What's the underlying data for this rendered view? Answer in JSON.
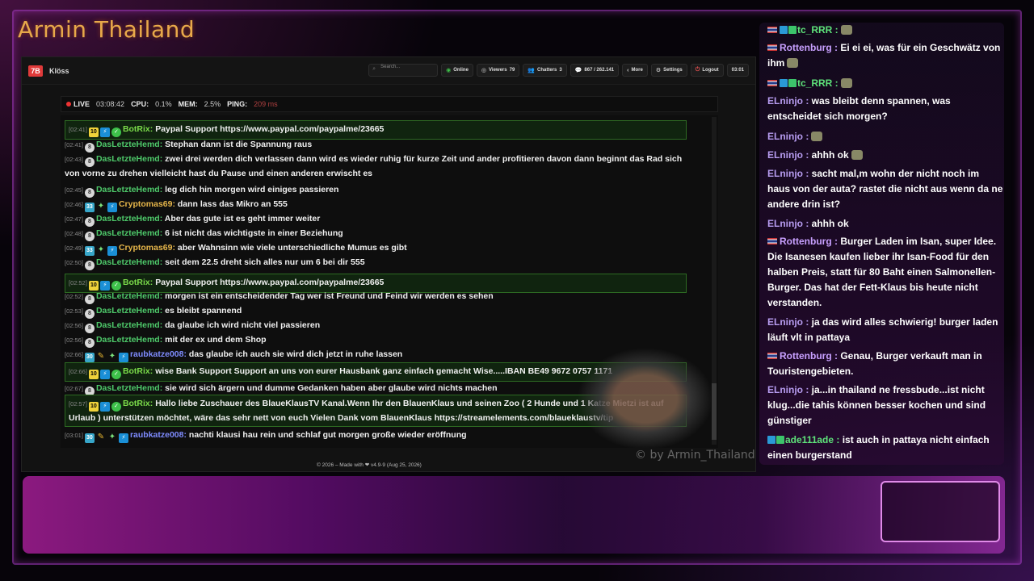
{
  "channel_title": "Armin Thailand",
  "app": {
    "name": "Klöss",
    "search_placeholder": "Search...",
    "online_label": "Online",
    "viewers_label": "Viewers",
    "viewers_count": "79",
    "chatters_label": "Chatters",
    "chatters_count": "3",
    "messages_count": "867 / 262.141",
    "more_label": "More",
    "settings_label": "Settings",
    "logout_label": "Logout",
    "clock": "03:01"
  },
  "status": {
    "live_label": "LIVE",
    "live_time": "03:08:42",
    "cpu_label": "CPU:",
    "cpu_value": "0.1%",
    "mem_label": "MEM:",
    "mem_value": "2.5%",
    "ping_label": "PING:",
    "ping_value": "209 ms"
  },
  "chat": [
    {
      "ts": "[02:41]",
      "badge": "10",
      "user": "BotRix:",
      "text": " Paypal Support https://www.paypal.com/paypalme/23665",
      "kind": "bot"
    },
    {
      "ts": "[02:41]",
      "badge": "8",
      "user": "DasLetzteHemd:",
      "text": " Stephan dann ist die Spannung raus",
      "kind": "green"
    },
    {
      "ts": "[02:43]",
      "badge": "8",
      "user": "DasLetzteHemd:",
      "text": " zwei drei werden dich verlassen dann wird es wieder ruhig für kurze Zeit und ander profitieren davon dann beginnt das Rad sich von vorne zu drehen vielleicht hast du Pause und einen anderen erwischt es",
      "kind": "green"
    },
    {
      "ts": "[02:45]",
      "badge": "8",
      "user": "DasLetzteHemd:",
      "text": " leg dich hin morgen wird einiges passieren",
      "kind": "green"
    },
    {
      "ts": "[02:46]",
      "badge": "33",
      "user": "Cryptomas69:",
      "text": " dann lass das Mikro an 555",
      "kind": "yellow"
    },
    {
      "ts": "[02:47]",
      "badge": "8",
      "user": "DasLetzteHemd:",
      "text": " Aber das gute ist es geht immer weiter",
      "kind": "green"
    },
    {
      "ts": "[02:48]",
      "badge": "8",
      "user": "DasLetzteHemd:",
      "text": " 6 ist nicht das wichtigste in einer Beziehung",
      "kind": "green"
    },
    {
      "ts": "[02:49]",
      "badge": "33",
      "user": "Cryptomas69:",
      "text": " aber Wahnsinn wie viele unterschiedliche Mumus es gibt",
      "kind": "yellow"
    },
    {
      "ts": "[02:50]",
      "badge": "8",
      "user": "DasLetzteHemd:",
      "text": " seit dem 22.5 dreht sich alles nur um 6 bei dir 555",
      "kind": "green"
    },
    {
      "ts": "[02:52]",
      "badge": "10",
      "user": "BotRix:",
      "text": " Paypal Support https://www.paypal.com/paypalme/23665",
      "kind": "bot"
    },
    {
      "ts": "[02:52]",
      "badge": "8",
      "user": "DasLetzteHemd:",
      "text": " morgen ist ein entscheidender Tag wer ist Freund und Feind wir werden es sehen",
      "kind": "green"
    },
    {
      "ts": "[02:53]",
      "badge": "8",
      "user": "DasLetzteHemd:",
      "text": " es bleibt spannend",
      "kind": "green"
    },
    {
      "ts": "[02:56]",
      "badge": "8",
      "user": "DasLetzteHemd:",
      "text": " da glaube ich wird nicht viel passieren",
      "kind": "green"
    },
    {
      "ts": "[02:56]",
      "badge": "8",
      "user": "DasLetzteHemd:",
      "text": " mit der ex und dem Shop",
      "kind": "green"
    },
    {
      "ts": "[02:66]",
      "badge": "30",
      "user": "raubkatze008:",
      "text": " das glaube ich auch sie wird dich jetzt in ruhe lassen",
      "kind": "blue"
    },
    {
      "ts": "[02:66]",
      "badge": "10",
      "user": "BotRix:",
      "text": " wise Bank Support Support an uns von eurer Hausbank ganz einfach gemacht Wise.....IBAN BE49 9672 0757 1171",
      "kind": "bot"
    },
    {
      "ts": "[02:67]",
      "badge": "8",
      "user": "DasLetzteHemd:",
      "text": " sie wird sich ärgern und dumme Gedanken haben aber glaube wird nichts machen",
      "kind": "green"
    },
    {
      "ts": "[02:57]",
      "badge": "10",
      "user": "BotRix:",
      "text": " Hallo liebe Zuschauer des BlaueKlausTV Kanal.Wenn Ihr den BlauenKlaus und seinen Zoo ( 2 Hunde und 1 Katze Mietzi ist auf Urlaub ) unterstützen möchtet, wäre das sehr nett von euch Vielen Dank vom BlauenKlaus https://streamelements.com/blaueklaustv/tip",
      "kind": "bot"
    },
    {
      "ts": "[03:01]",
      "badge": "30",
      "user": "raubkatze008:",
      "text": " nachti klausi hau rein und schlaf gut morgen große wieder eröffnung",
      "kind": "blue"
    }
  ],
  "footer_credit": "© 2026 – Made with ❤ v4.9-9 (Aug 25, 2026)",
  "watermark": "© by Armin_Thailand",
  "side_chat": [
    {
      "user": "tc_RRR :",
      "text": "",
      "kind": "tc"
    },
    {
      "user": "Rottenburg :",
      "text": " Ei ei ei, was für ein Geschwätz von ihm",
      "kind": "rot"
    },
    {
      "user": "tc_RRR :",
      "text": "",
      "kind": "tc"
    },
    {
      "user": "ELninjo :",
      "text": " was bleibt denn spannen, was entscheidet sich morgen?",
      "kind": "el"
    },
    {
      "user": "ELninjo :",
      "text": "",
      "kind": "el"
    },
    {
      "user": "ELninjo :",
      "text": " ahhh ok",
      "kind": "el"
    },
    {
      "user": "ELninjo :",
      "text": " sacht mal,m wohn der nicht noch im haus von der auta? rastet die nicht aus wenn da ne andere drin ist?",
      "kind": "el"
    },
    {
      "user": "ELninjo :",
      "text": " ahhh ok",
      "kind": "el"
    },
    {
      "user": "Rottenburg :",
      "text": " Burger Laden im Isan, super Idee. Die Isanesen kaufen lieber ihr Isan-Food für den halben Preis, statt für 80 Baht einen Salmonellen-Burger. Das hat der Fett-Klaus bis heute nicht verstanden.",
      "kind": "rot"
    },
    {
      "user": "ELninjo :",
      "text": " ja das wird alles schwierig! burger laden läuft vlt in pattaya",
      "kind": "el"
    },
    {
      "user": "Rottenburg :",
      "text": " Genau, Burger verkauft man in Touristengebieten.",
      "kind": "rot"
    },
    {
      "user": "ELninjo :",
      "text": " ja...in thailand ne fressbude...ist nicht klug...die tahis können besser kochen und sind günstiger",
      "kind": "el"
    },
    {
      "user": "ade111ade :",
      "text": " ist auch in pattaya nicht einfach einen burgerstand",
      "kind": "ad"
    }
  ]
}
